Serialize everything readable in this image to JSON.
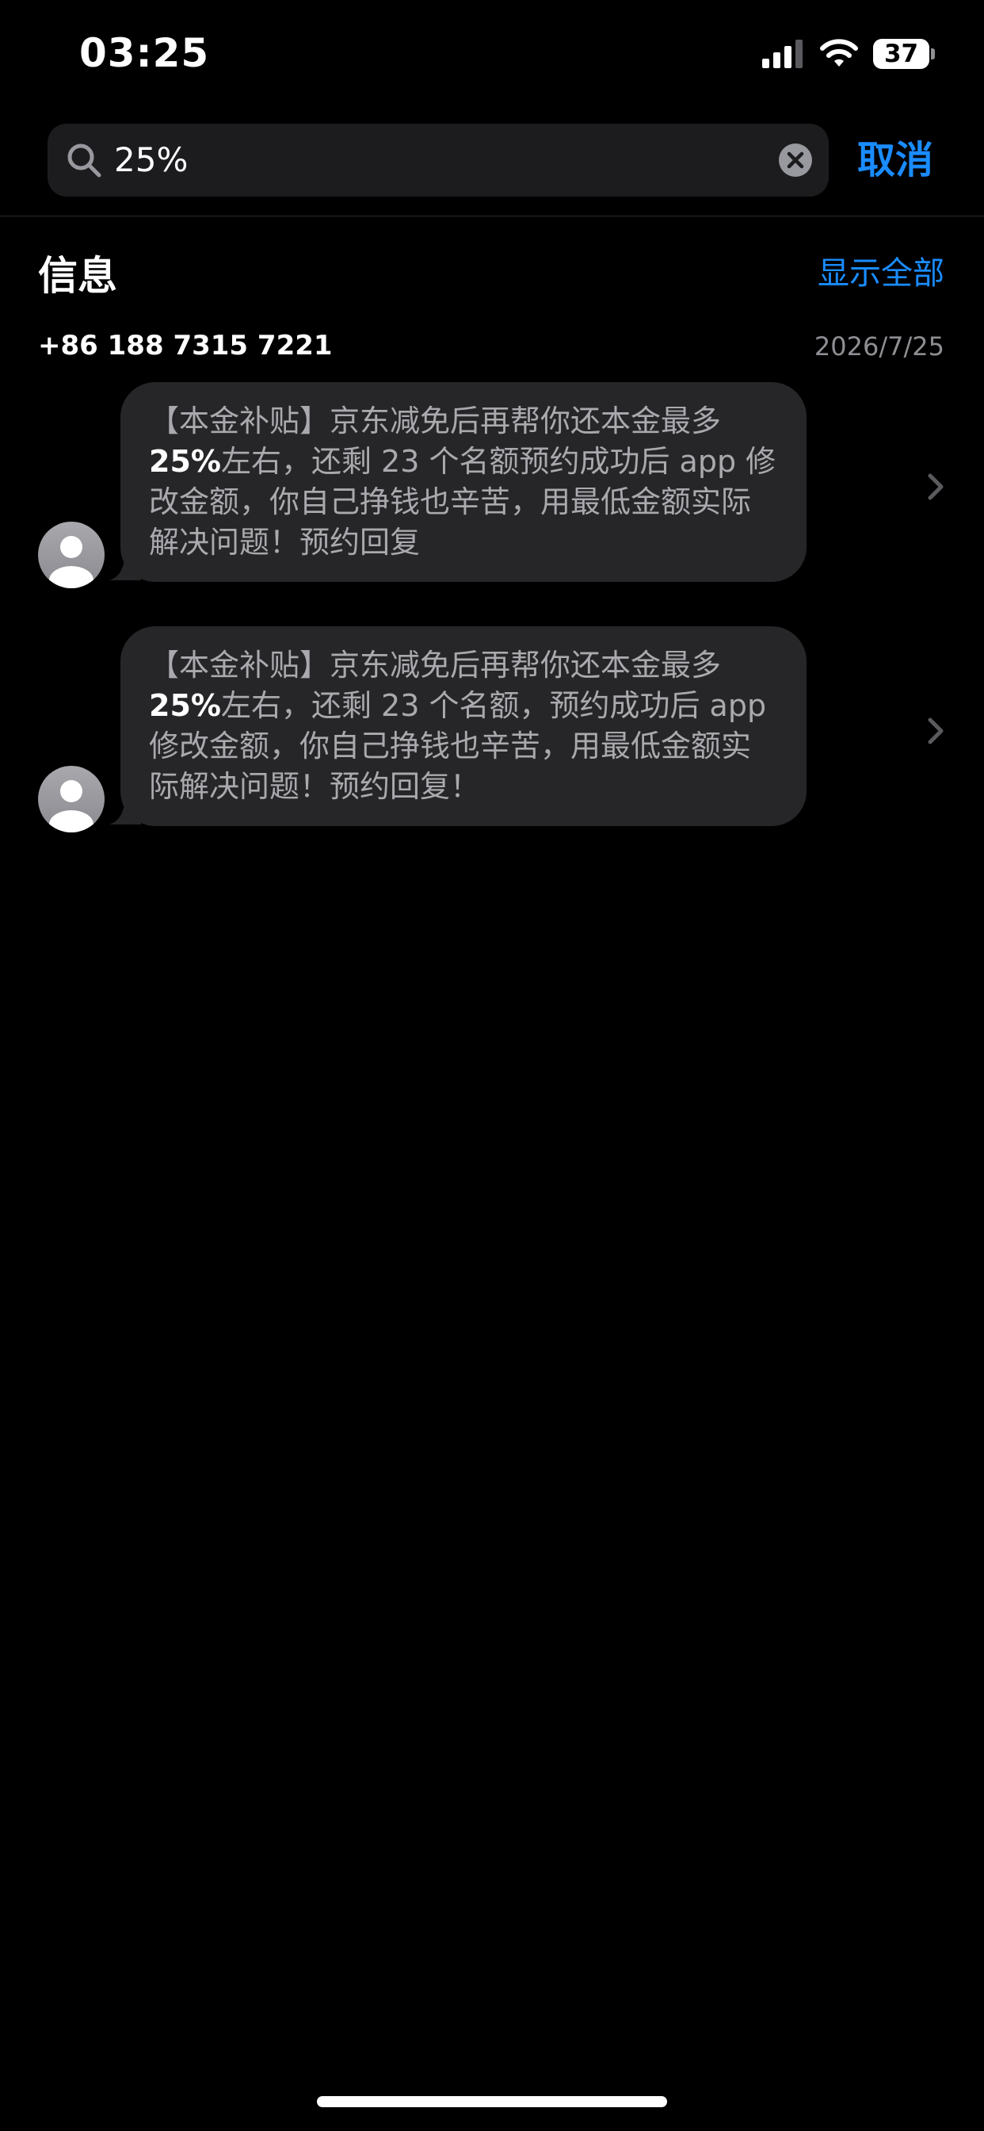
{
  "status_bar": {
    "time": "03:25",
    "battery": "37"
  },
  "search": {
    "query": "25%",
    "cancel_label": "取消"
  },
  "section": {
    "title": "信息",
    "show_all_label": "显示全部"
  },
  "conversation": {
    "sender": "+86 188 7315 7221",
    "date": "2026/7/25"
  },
  "messages": [
    {
      "before": "【本金补贴】京东减免后再帮你还本金最多",
      "highlight": "25%",
      "after": "左右，还剩 23 个名额预约成功后 app 修改金额，你自己挣钱也辛苦，用最低金额实际解决问题！预约回复"
    },
    {
      "before": "【本金补贴】京东减免后再帮你还本金最多",
      "highlight": "25%",
      "after": "左右，还剩 23 个名额，预约成功后 app 修改金额，你自己挣钱也辛苦，用最低金额实际解决问题！预约回复！"
    }
  ],
  "colors": {
    "background": "#000000",
    "accent": "#1a8cff",
    "bubble": "#262628",
    "secondary_text": "#8e8e93"
  }
}
